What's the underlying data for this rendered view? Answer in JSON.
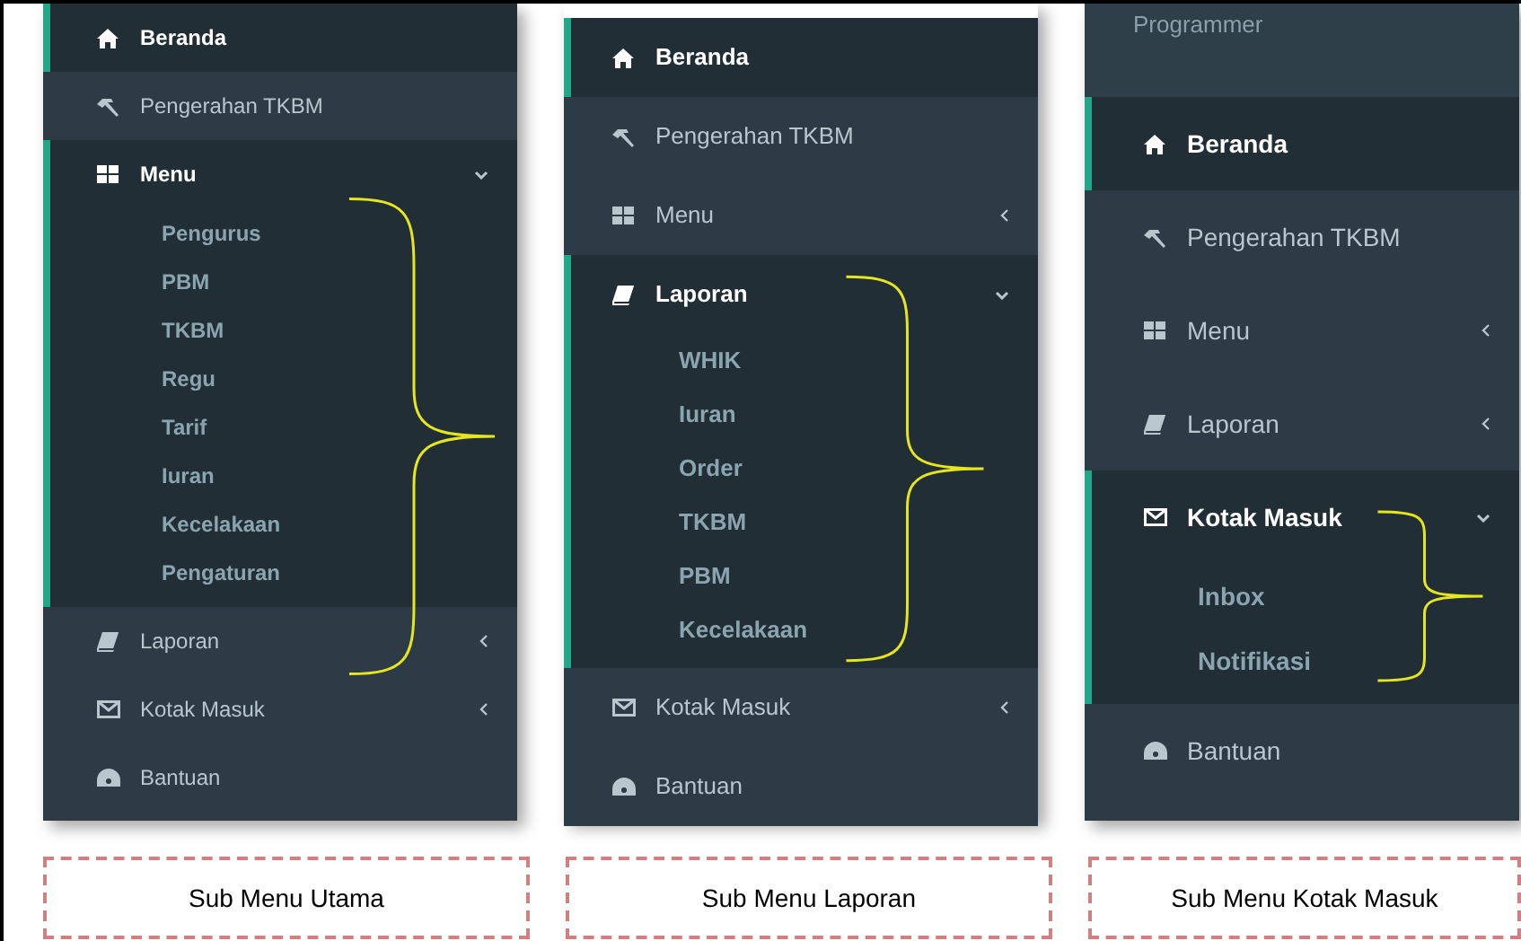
{
  "panels": [
    {
      "items": [
        {
          "kind": "link",
          "label": "Beranda",
          "active": true
        },
        {
          "kind": "link",
          "label": "Pengerahan TKBM",
          "active": false
        },
        {
          "kind": "group",
          "label": "Menu",
          "active": true,
          "expanded": true,
          "children": [
            "Pengurus",
            "PBM",
            "TKBM",
            "Regu",
            "Tarif",
            "Iuran",
            "Kecelakaan",
            "Pengaturan"
          ]
        },
        {
          "kind": "group",
          "label": "Laporan",
          "active": false,
          "expanded": false
        },
        {
          "kind": "group",
          "label": "Kotak Masuk",
          "active": false,
          "expanded": false
        },
        {
          "kind": "link",
          "label": "Bantuan",
          "active": false
        }
      ],
      "caption": "Sub Menu Utama"
    },
    {
      "items": [
        {
          "kind": "link",
          "label": "Beranda",
          "active": true
        },
        {
          "kind": "link",
          "label": "Pengerahan TKBM",
          "active": false
        },
        {
          "kind": "group",
          "label": "Menu",
          "active": false,
          "expanded": false
        },
        {
          "kind": "group",
          "label": "Laporan",
          "active": true,
          "expanded": true,
          "children": [
            "WHIK",
            "Iuran",
            "Order",
            "TKBM",
            "PBM",
            "Kecelakaan"
          ]
        },
        {
          "kind": "group",
          "label": "Kotak Masuk",
          "active": false,
          "expanded": false
        },
        {
          "kind": "link",
          "label": "Bantuan",
          "active": false
        }
      ],
      "caption": "Sub Menu Laporan"
    },
    {
      "header": "Programmer",
      "items": [
        {
          "kind": "link",
          "label": "Beranda",
          "active": true
        },
        {
          "kind": "link",
          "label": "Pengerahan TKBM",
          "active": false
        },
        {
          "kind": "group",
          "label": "Menu",
          "active": false,
          "expanded": false
        },
        {
          "kind": "group",
          "label": "Laporan",
          "active": false,
          "expanded": false
        },
        {
          "kind": "group",
          "label": "Kotak Masuk",
          "active": true,
          "expanded": true,
          "children": [
            "Inbox",
            "Notifikasi"
          ]
        },
        {
          "kind": "link",
          "label": "Bantuan",
          "active": false
        }
      ],
      "caption": "Sub Menu Kotak Masuk"
    }
  ]
}
